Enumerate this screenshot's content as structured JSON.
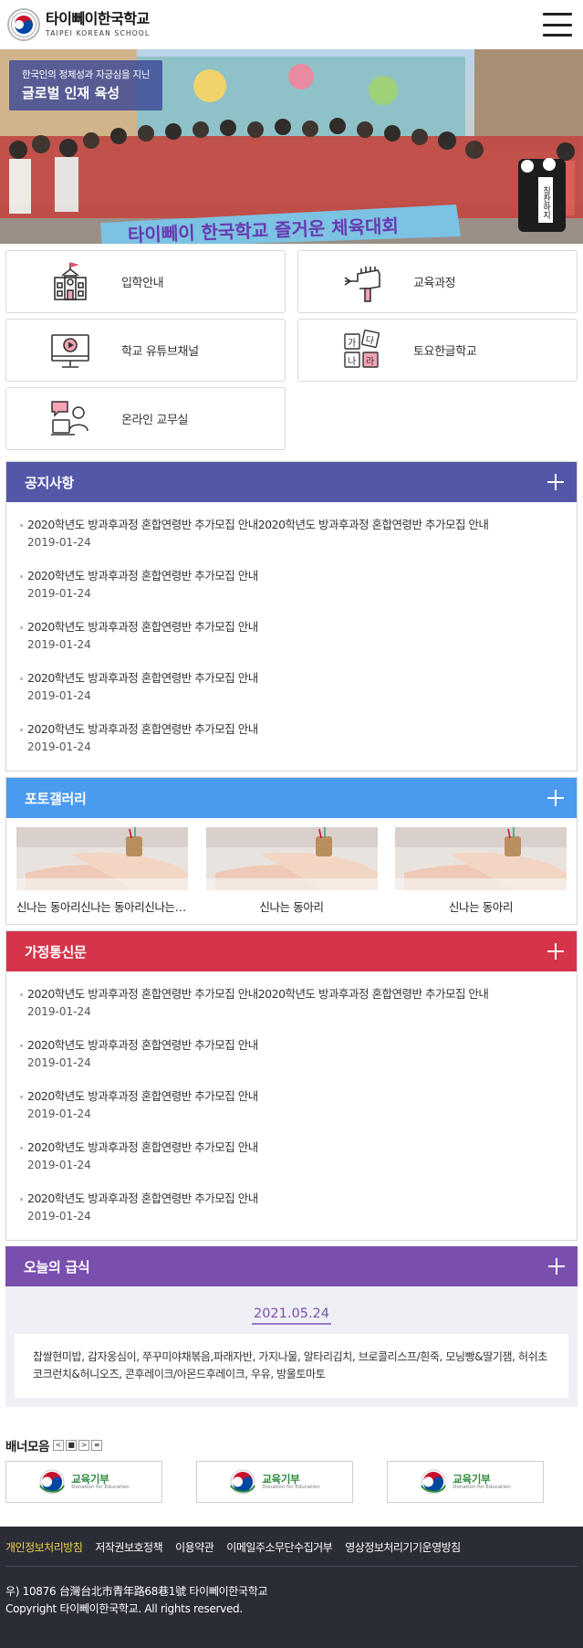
{
  "header": {
    "title": "타이뻬이한국학교",
    "subtitle": "TAIPEI KOREAN SCHOOL",
    "menu_icon": "hamburger-menu-icon"
  },
  "hero": {
    "caption_small": "한국인의 정체성과 자긍심을 지닌",
    "caption_big": "글로벌 인재 육성",
    "banner_text": "타이뻬이 한국학교 즐거운 체육대회",
    "mascot_text": "칭찬하지"
  },
  "quick_menu": [
    {
      "label": "입학안내",
      "icon": "school-building-icon"
    },
    {
      "label": "교육과정",
      "icon": "hand-pen-icon"
    },
    {
      "label": "학교 유튜브채널",
      "icon": "monitor-play-icon"
    },
    {
      "label": "토요한글학교",
      "icon": "hangul-blocks-icon"
    },
    {
      "label": "온라인 교무실",
      "icon": "online-teacher-icon"
    }
  ],
  "hangul_blocks": [
    "가",
    "다",
    "나",
    "라"
  ],
  "notice": {
    "title": "공지사항",
    "color": "#5257a8",
    "items": [
      {
        "title": "2020학년도 방과후과정 혼합연령반 추가모집 안내2020학년도 방과후과정 혼합연령반 추가모집 안내",
        "date": "2019-01-24"
      },
      {
        "title": "2020학년도 방과후과정 혼합연령반 추가모집 안내",
        "date": "2019-01-24"
      },
      {
        "title": "2020학년도 방과후과정 혼합연령반 추가모집 안내",
        "date": "2019-01-24"
      },
      {
        "title": "2020학년도 방과후과정 혼합연령반 추가모집 안내",
        "date": "2019-01-24"
      },
      {
        "title": "2020학년도 방과후과정 혼합연령반 추가모집 안내",
        "date": "2019-01-24"
      }
    ]
  },
  "gallery": {
    "title": "포토갤러리",
    "color": "#4a9af0",
    "items": [
      {
        "caption": "신나는 동아리신나는 동아리신나는 동아리"
      },
      {
        "caption": "신나는 동아리"
      },
      {
        "caption": "신나는 동아리"
      }
    ]
  },
  "newsletter": {
    "title": "가정통신문",
    "color": "#d5344a",
    "items": [
      {
        "title": "2020학년도 방과후과정 혼합연령반 추가모집 안내2020학년도 방과후과정 혼합연령반 추가모집 안내",
        "date": "2019-01-24"
      },
      {
        "title": "2020학년도 방과후과정 혼합연령반 추가모집 안내",
        "date": "2019-01-24"
      },
      {
        "title": "2020학년도 방과후과정 혼합연령반 추가모집 안내",
        "date": "2019-01-24"
      },
      {
        "title": "2020학년도 방과후과정 혼합연령반 추가모집 안내",
        "date": "2019-01-24"
      },
      {
        "title": "2020학년도 방과후과정 혼합연령반 추가모집 안내",
        "date": "2019-01-24"
      }
    ]
  },
  "lunch": {
    "title": "오늘의 급식",
    "color": "#7b4fae",
    "date": "2021.05.24",
    "menu": "찹쌀현미밥, 감자옹심이, 쭈꾸미야채볶음,파래자반, 가지나물, 알타리김치, 브로콜리스프/흰죽, 모닝빵&딸기잼, 허쉬초코크런치&허니오즈, 콘후레이크/아몬드후레이크, 우유, 방울토마토"
  },
  "banner": {
    "title": "배너모음",
    "controls": [
      "<",
      "■",
      ">",
      "≡"
    ],
    "items": [
      {
        "label": "교육기부",
        "sub": "Donation for Education"
      },
      {
        "label": "교육기부",
        "sub": "Donation for Education"
      },
      {
        "label": "교육기부",
        "sub": "Donation for Education"
      }
    ]
  },
  "footer": {
    "links": [
      {
        "label": "개인정보처리방침",
        "highlight": true
      },
      {
        "label": "저작권보호정책",
        "highlight": false
      },
      {
        "label": "이용약관",
        "highlight": false
      },
      {
        "label": "이메일주소무단수집거부",
        "highlight": false
      },
      {
        "label": "영상정보처리기기운영방침",
        "highlight": false
      }
    ],
    "address": "우) 10876 台灣台北市青年路68巷1號 타이뻬이한국학교",
    "copyright": "Copyright 타이뻬이한국학교. All rights reserved."
  }
}
